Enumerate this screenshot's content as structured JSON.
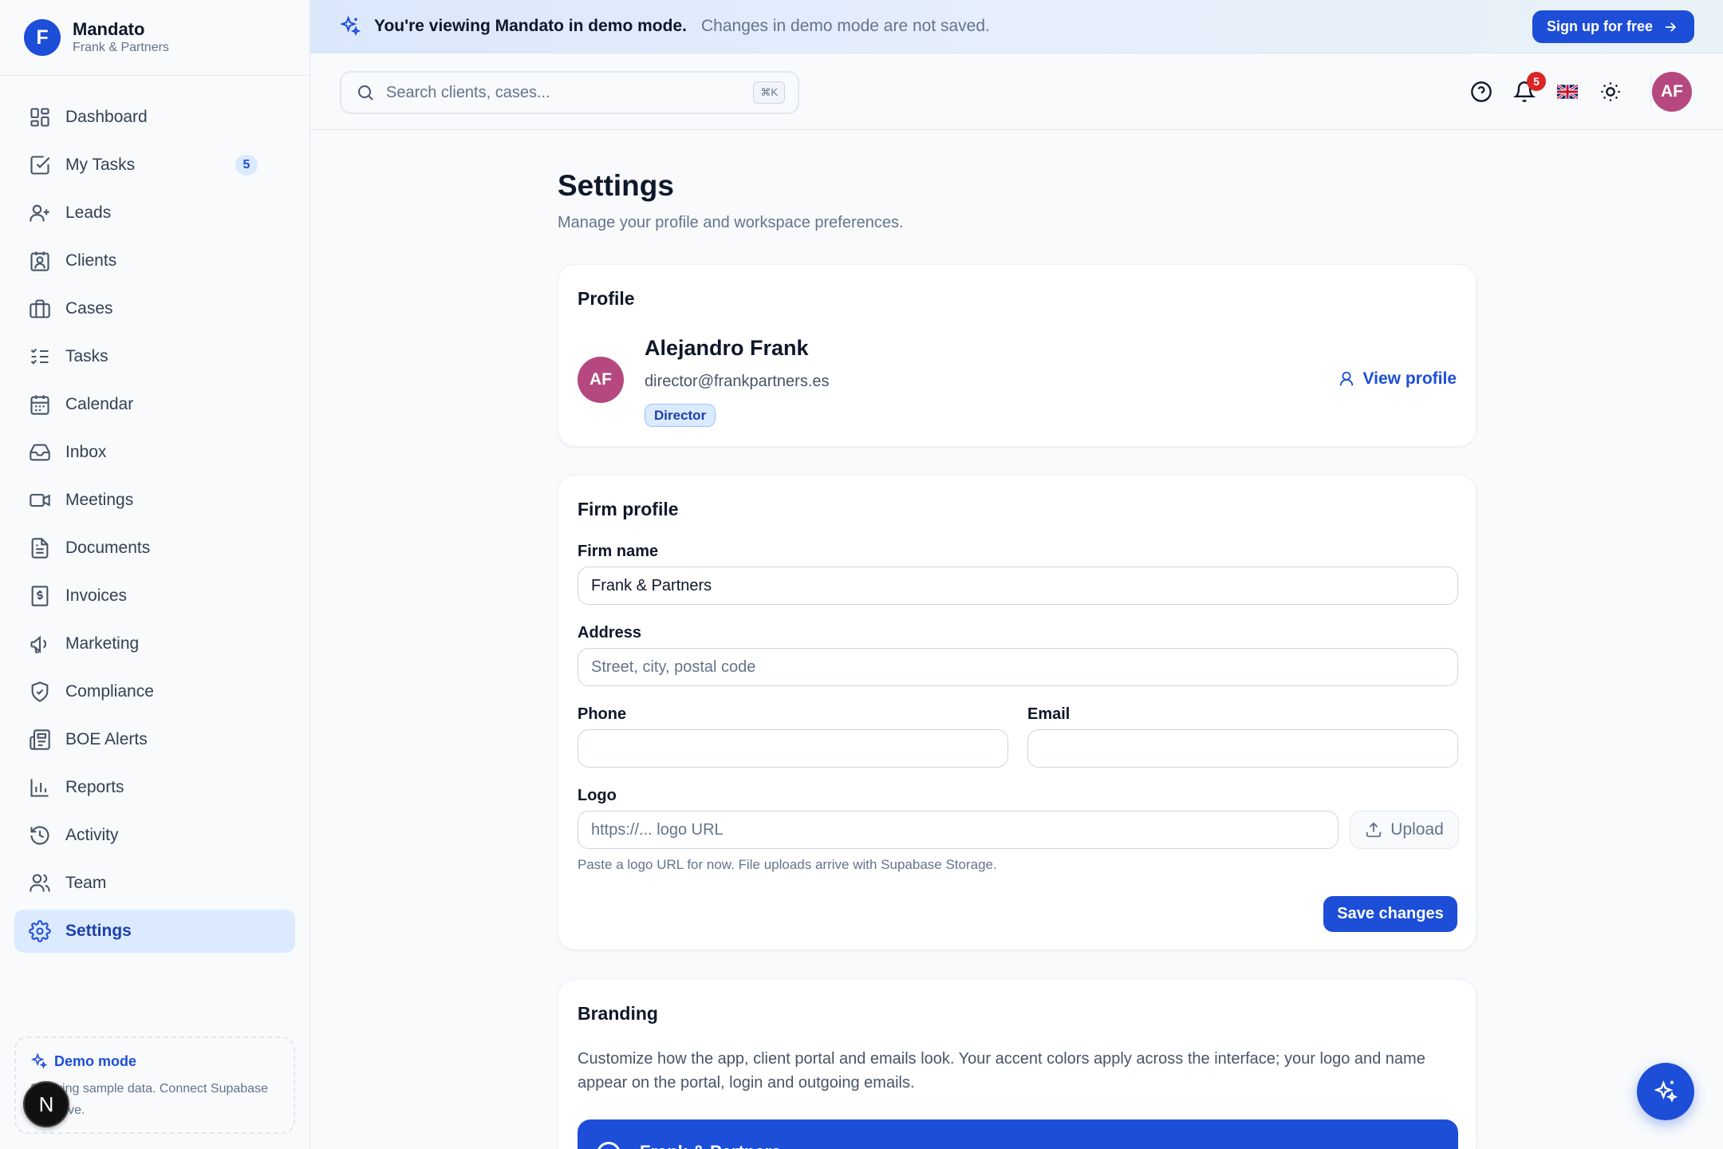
{
  "brand": {
    "initial": "F",
    "name": "Mandato",
    "subtitle": "Frank & Partners"
  },
  "sidebar": {
    "items": [
      {
        "label": "Dashboard",
        "icon": "dashboard-icon"
      },
      {
        "label": "My Tasks",
        "icon": "check-square-icon",
        "badge": "5"
      },
      {
        "label": "Leads",
        "icon": "user-plus-icon"
      },
      {
        "label": "Clients",
        "icon": "contact-icon"
      },
      {
        "label": "Cases",
        "icon": "briefcase-icon"
      },
      {
        "label": "Tasks",
        "icon": "list-checks-icon"
      },
      {
        "label": "Calendar",
        "icon": "calendar-icon"
      },
      {
        "label": "Inbox",
        "icon": "inbox-icon"
      },
      {
        "label": "Meetings",
        "icon": "video-icon"
      },
      {
        "label": "Documents",
        "icon": "file-text-icon"
      },
      {
        "label": "Invoices",
        "icon": "receipt-dollar-icon"
      },
      {
        "label": "Marketing",
        "icon": "megaphone-icon"
      },
      {
        "label": "Compliance",
        "icon": "shield-check-icon"
      },
      {
        "label": "BOE Alerts",
        "icon": "newspaper-icon"
      },
      {
        "label": "Reports",
        "icon": "bar-chart-icon"
      },
      {
        "label": "Activity",
        "icon": "history-icon"
      },
      {
        "label": "Team",
        "icon": "users-icon"
      },
      {
        "label": "Settings",
        "icon": "gear-icon",
        "active": true
      }
    ],
    "demo": {
      "title": "Demo mode",
      "text_line1": "Showing sample data. Connect Supabase",
      "text_line2": "to go live."
    },
    "n_badge": "N"
  },
  "banner": {
    "strong": "You're viewing Mandato in demo mode.",
    "muted": "Changes in demo mode are not saved.",
    "signup": "Sign up for free"
  },
  "toolbar": {
    "search_placeholder": "Search clients, cases...",
    "shortcut": "⌘K",
    "notifications_count": "5",
    "avatar_initials": "AF"
  },
  "page": {
    "title": "Settings",
    "subtitle": "Manage your profile and workspace preferences."
  },
  "profile": {
    "section_title": "Profile",
    "initials": "AF",
    "name": "Alejandro Frank",
    "email": "director@frankpartners.es",
    "role": "Director",
    "view_profile": "View profile"
  },
  "firm": {
    "section_title": "Firm profile",
    "name_label": "Firm name",
    "name_value": "Frank & Partners",
    "address_label": "Address",
    "address_placeholder": "Street, city, postal code",
    "phone_label": "Phone",
    "phone_value": "",
    "email_label": "Email",
    "email_value": "",
    "logo_label": "Logo",
    "logo_placeholder": "https://... logo URL",
    "upload_label": "Upload",
    "logo_help": "Paste a logo URL for now. File uploads arrive with Supabase Storage.",
    "save_label": "Save changes"
  },
  "branding": {
    "section_title": "Branding",
    "description": "Customize how the app, client portal and emails look. Your accent colors apply across the interface; your logo and name appear on the portal, login and outgoing emails.",
    "preview_name": "Frank & Partners"
  },
  "colors": {
    "accent": "#1d4ed8",
    "avatar": "#b5497f",
    "notification": "#dc2626"
  }
}
